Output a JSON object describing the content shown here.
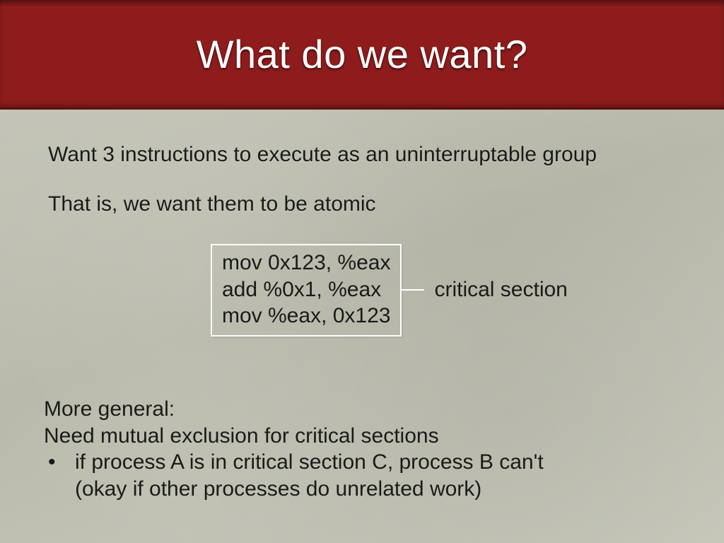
{
  "title": "What do we want?",
  "p1": "Want 3 instructions to execute as an uninterruptable group",
  "p2": "That is, we want them to be atomic",
  "code": {
    "line1": "mov 0x123, %eax",
    "line2": "add %0x1, %eax",
    "line3": "mov %eax, 0x123"
  },
  "cs_label": "critical section",
  "bottom": {
    "line1": "More general:",
    "line2": "Need mutual exclusion for critical sections",
    "bullet_sym": "•",
    "bullet_line1": "if process A is in critical section C, process B can't",
    "bullet_line2": "(okay if other processes do unrelated work)"
  }
}
